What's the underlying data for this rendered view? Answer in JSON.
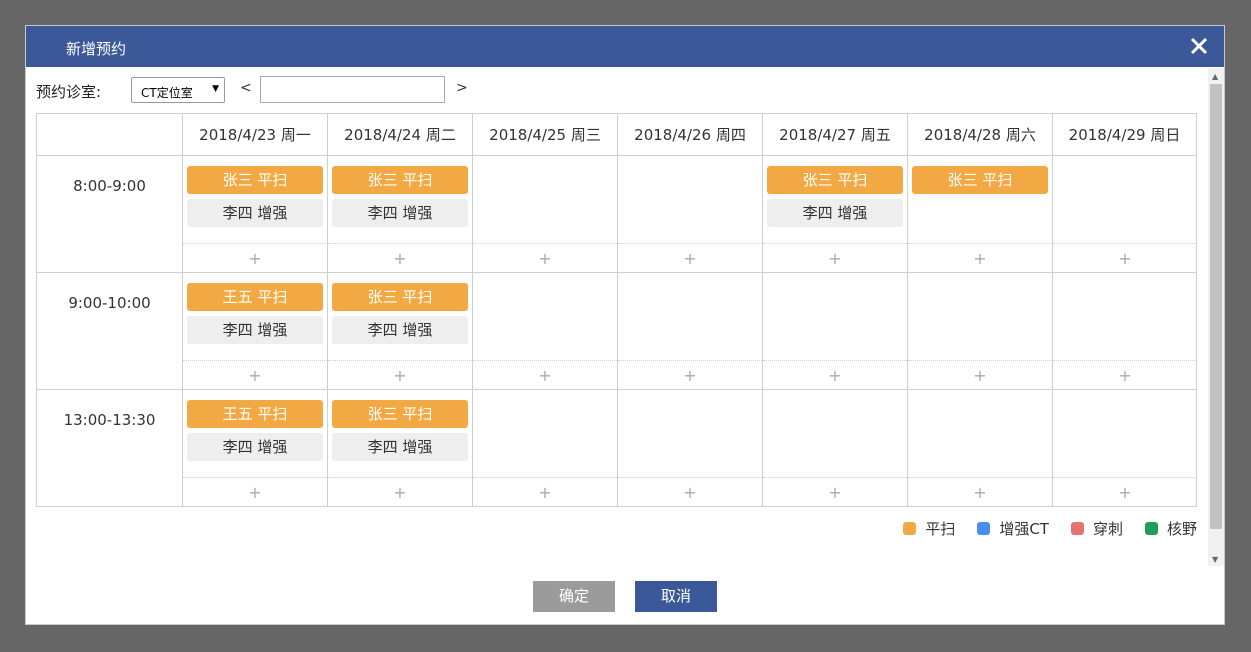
{
  "dialog": {
    "title": "新增预约",
    "close_icon": "close-icon"
  },
  "toolbar": {
    "room_label": "预约诊室:",
    "room_selected": "CT定位室",
    "prev_label": "<",
    "next_label": ">",
    "date_value": ""
  },
  "schedule": {
    "days": [
      "2018/4/23 周一",
      "2018/4/24 周二",
      "2018/4/25 周三",
      "2018/4/26 周四",
      "2018/4/27 周五",
      "2018/4/28 周六",
      "2018/4/29 周日"
    ],
    "add_symbol": "+",
    "slots": [
      {
        "time": "8:00-9:00",
        "cells": [
          [
            {
              "text": "张三 平扫",
              "kind": "orange"
            },
            {
              "text": "李四 增强",
              "kind": "gray"
            }
          ],
          [
            {
              "text": "张三 平扫",
              "kind": "orange"
            },
            {
              "text": "李四 增强",
              "kind": "gray"
            }
          ],
          [],
          [],
          [
            {
              "text": "张三 平扫",
              "kind": "orange"
            },
            {
              "text": "李四 增强",
              "kind": "gray"
            }
          ],
          [
            {
              "text": "张三 平扫",
              "kind": "orange"
            }
          ],
          []
        ]
      },
      {
        "time": "9:00-10:00",
        "cells": [
          [
            {
              "text": "王五 平扫",
              "kind": "orange"
            },
            {
              "text": "李四 增强",
              "kind": "gray"
            }
          ],
          [
            {
              "text": "张三 平扫",
              "kind": "orange"
            },
            {
              "text": "李四 增强",
              "kind": "gray"
            }
          ],
          [],
          [],
          [],
          [],
          []
        ]
      },
      {
        "time": "13:00-13:30",
        "cells": [
          [
            {
              "text": "王五 平扫",
              "kind": "orange"
            },
            {
              "text": "李四 增强",
              "kind": "gray"
            }
          ],
          [
            {
              "text": "张三 平扫",
              "kind": "orange"
            },
            {
              "text": "李四 增强",
              "kind": "gray"
            }
          ],
          [],
          [],
          [],
          [],
          []
        ]
      }
    ]
  },
  "legend": [
    {
      "label": "平扫",
      "color": "#f2a944"
    },
    {
      "label": "增强CT",
      "color": "#4a8df0"
    },
    {
      "label": "穿刺",
      "color": "#e57373"
    },
    {
      "label": "核野",
      "color": "#1e9e5a"
    }
  ],
  "buttons": {
    "ok": "确定",
    "cancel": "取消"
  },
  "colors": {
    "titlebar": "#3b5998",
    "overlay": "#666666",
    "orange": "#f2a944",
    "gray_chip": "#eeeeee",
    "ok_button": "#9b9b9b"
  }
}
